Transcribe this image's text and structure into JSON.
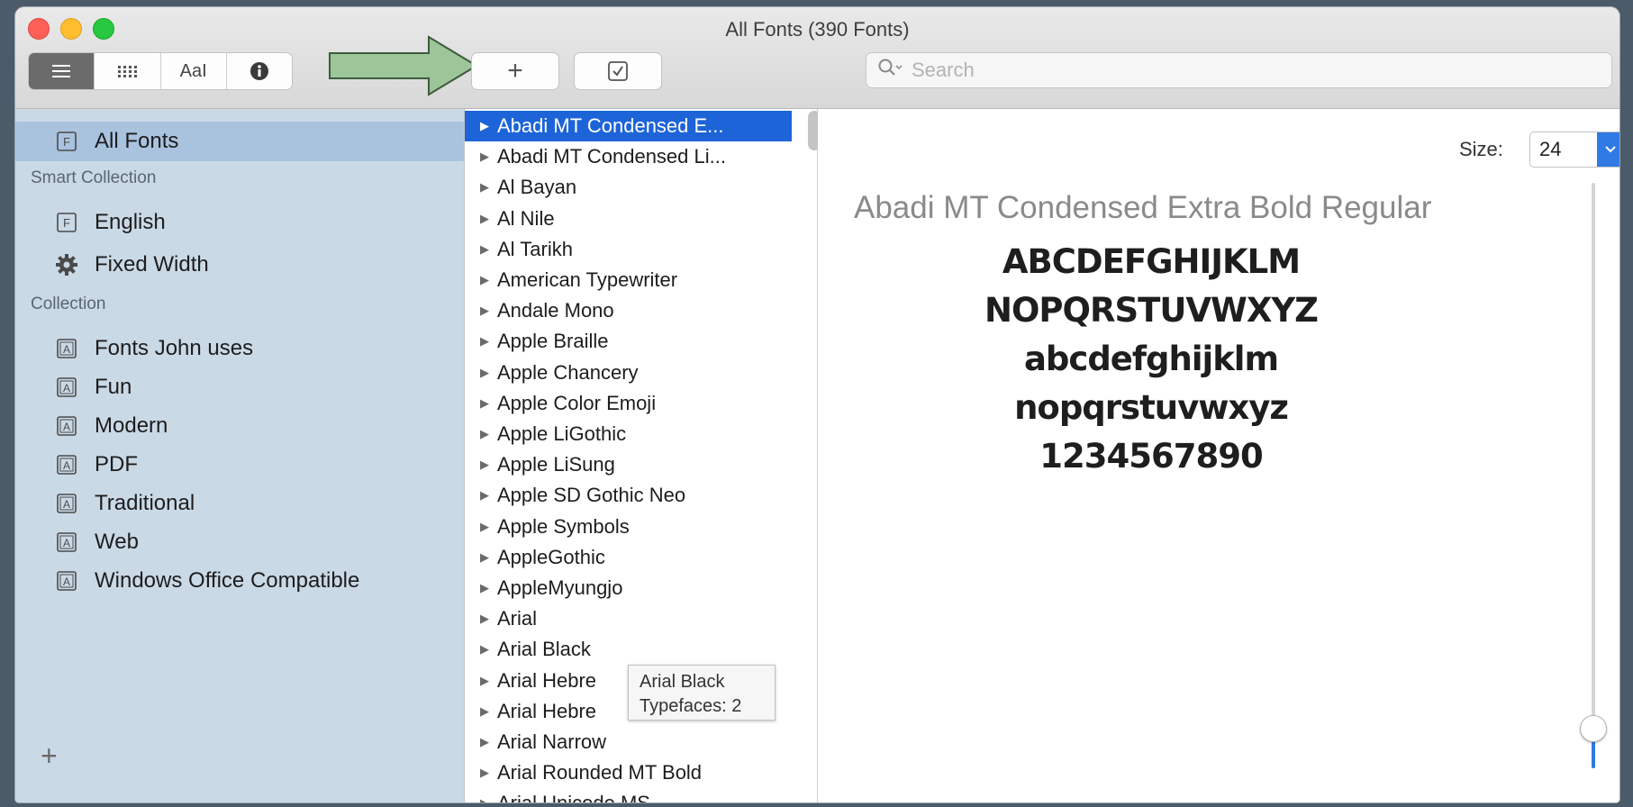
{
  "window": {
    "title": "All Fonts (390 Fonts)"
  },
  "toolbar": {
    "view_buttons": [
      "sidebar-view",
      "grid-view",
      "AaI",
      "info"
    ],
    "add_label": "+",
    "search_placeholder": "Search"
  },
  "sidebar": {
    "all_fonts": "All Fonts",
    "smart_collection_header": "Smart Collection",
    "smart_items": [
      "English",
      "Fixed Width"
    ],
    "collection_header": "Collection",
    "collections": [
      "Fonts John uses",
      "Fun",
      "Modern",
      "PDF",
      "Traditional",
      "Web",
      "Windows Office Compatible"
    ],
    "add_label": "+"
  },
  "font_list": {
    "selected_index": 0,
    "items": [
      "Abadi MT Condensed E...",
      "Abadi MT Condensed Li...",
      "Al Bayan",
      "Al Nile",
      "Al Tarikh",
      "American Typewriter",
      "Andale Mono",
      "Apple Braille",
      "Apple Chancery",
      "Apple Color Emoji",
      "Apple LiGothic",
      "Apple LiSung",
      "Apple SD Gothic Neo",
      "Apple Symbols",
      "AppleGothic",
      "AppleMyungjo",
      "Arial",
      "Arial Black",
      "Arial Hebre",
      "Arial Hebre",
      "Arial Narrow",
      "Arial Rounded MT Bold",
      "Arial Unicode MS"
    ]
  },
  "tooltip": {
    "line1": "Arial Black",
    "line2": "Typefaces: 2"
  },
  "preview": {
    "size_label": "Size:",
    "size_value": "24",
    "font_name": "Abadi MT Condensed Extra Bold Regular",
    "sample_lines": [
      "ABCDEFGHIJKLM",
      "NOPQRSTUVWXYZ",
      "abcdefghijklm",
      "nopqrstuvwxyz",
      "1234567890"
    ],
    "slider_value": 0.07
  },
  "colors": {
    "accent": "#1d64d8",
    "sidebar_bg": "#cad9e6",
    "annotation_arrow": "#9cc59a"
  }
}
